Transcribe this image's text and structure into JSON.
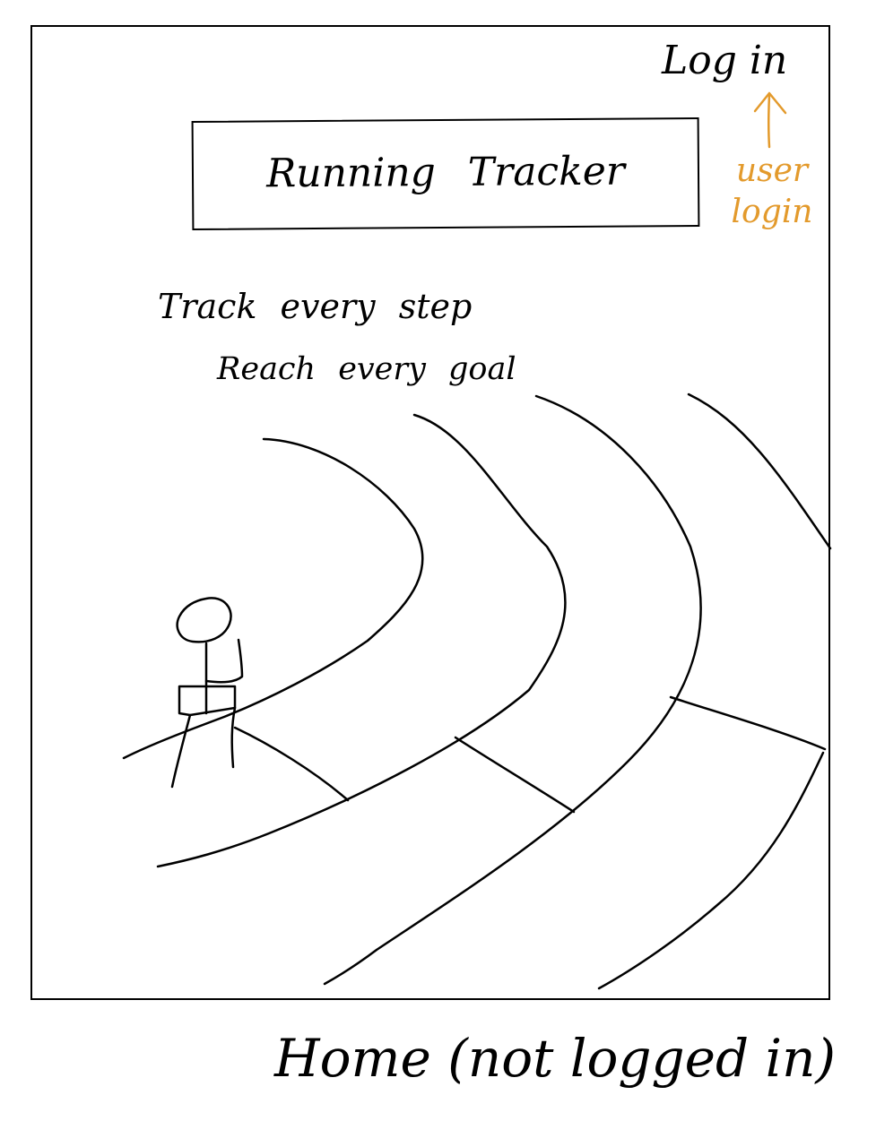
{
  "header": {
    "login_label": "Log in",
    "annotation_line1": "user",
    "annotation_line2": "login",
    "annotation_color": "#e39a2c"
  },
  "hero": {
    "title": "Running Tracker",
    "tagline_line1": "Track every step",
    "tagline_line2": "Reach every goal"
  },
  "illustration": {
    "subject": "running-track-icon",
    "figure": "stick-figure-runner-icon"
  },
  "caption": "Home (not logged in)"
}
